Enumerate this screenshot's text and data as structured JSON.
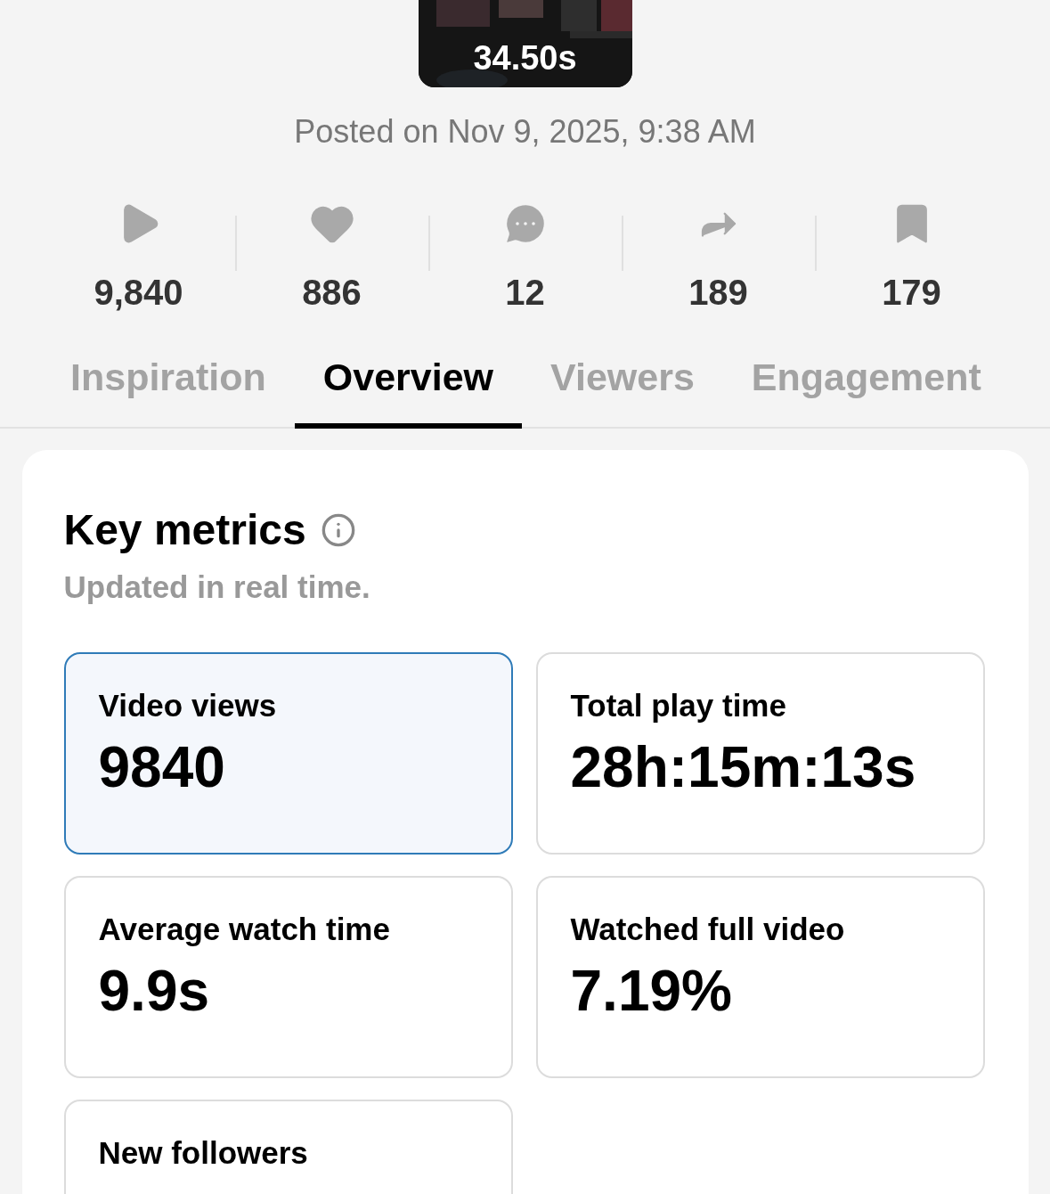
{
  "video": {
    "duration": "34.50s",
    "posted": "Posted on Nov 9, 2025, 9:38 AM"
  },
  "stats": [
    {
      "kind": "views",
      "value": "9,840"
    },
    {
      "kind": "likes",
      "value": "886"
    },
    {
      "kind": "comments",
      "value": "12"
    },
    {
      "kind": "shares",
      "value": "189"
    },
    {
      "kind": "saves",
      "value": "179"
    }
  ],
  "tabs": [
    {
      "label": "Inspiration",
      "selected": false
    },
    {
      "label": "Overview",
      "selected": true
    },
    {
      "label": "Viewers",
      "selected": false
    },
    {
      "label": "Engagement",
      "selected": false
    }
  ],
  "key_metrics": {
    "title": "Key metrics",
    "subtitle": "Updated in real time.",
    "tiles": [
      {
        "label": "Video views",
        "value": "9840",
        "selected": true
      },
      {
        "label": "Total play time",
        "value": "28h:15m:13s",
        "selected": false
      },
      {
        "label": "Average watch time",
        "value": "9.9s",
        "selected": false
      },
      {
        "label": "Watched full video",
        "value": "7.19%",
        "selected": false
      },
      {
        "label": "New followers",
        "selected": false
      }
    ]
  }
}
